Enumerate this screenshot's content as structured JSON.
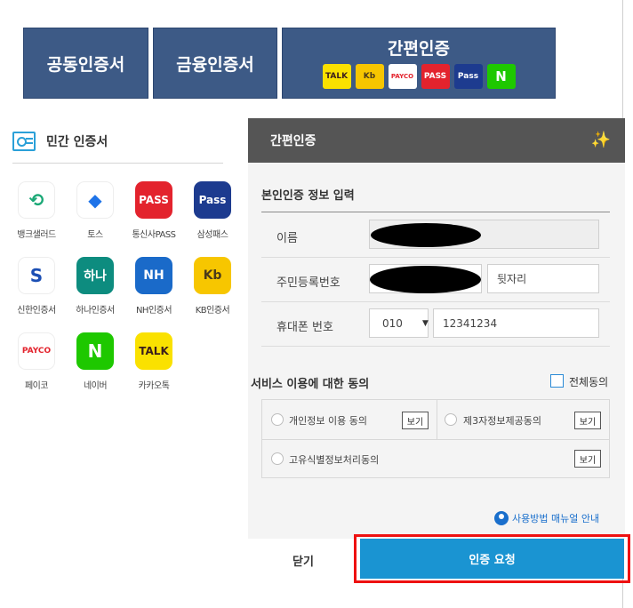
{
  "top_tabs": {
    "cert": "공동인증서",
    "financial": "금융인증서",
    "simple": "간편인증",
    "mini_icons": [
      "TALK",
      "Kb",
      "PAYCO",
      "PASS",
      "Pass",
      "N"
    ]
  },
  "private_certs": {
    "title": "민간 인증서",
    "apps": [
      {
        "name": "뱅크샐러드",
        "glyph": "⟲",
        "bg": "#ffffff",
        "fg": "#1aa876"
      },
      {
        "name": "토스",
        "glyph": "◆",
        "bg": "#ffffff",
        "fg": "#1e73e8"
      },
      {
        "name": "통신사PASS",
        "glyph": "PASS",
        "bg": "#e3232d",
        "fg": "#ffffff"
      },
      {
        "name": "삼성패스",
        "glyph": "Pass",
        "bg": "#1d3b8f",
        "fg": "#ffffff"
      },
      {
        "name": "신한인증서",
        "glyph": "S",
        "bg": "#ffffff",
        "fg": "#1c4fb4"
      },
      {
        "name": "하나인증서",
        "glyph": "하나",
        "bg": "#0d8c7f",
        "fg": "#ffffff"
      },
      {
        "name": "NH인증서",
        "glyph": "NH",
        "bg": "#1a6ac9",
        "fg": "#ffffff"
      },
      {
        "name": "KB인증서",
        "glyph": "Kb",
        "bg": "#f7c600",
        "fg": "#4a3a1a"
      },
      {
        "name": "페이코",
        "glyph": "PAYCO",
        "bg": "#ffffff",
        "fg": "#e3232d"
      },
      {
        "name": "네이버",
        "glyph": "N",
        "bg": "#1ec800",
        "fg": "#ffffff"
      },
      {
        "name": "카카오톡",
        "glyph": "TALK",
        "bg": "#fae100",
        "fg": "#3a1d1d"
      }
    ]
  },
  "panel": {
    "title": "간편인증",
    "section_info": "본인인증 정보 입력",
    "name_label": "이름",
    "rrn_label": "주민등록번호",
    "rrn_back_placeholder": "뒷자리",
    "phone_label": "휴대폰 번호",
    "phone_prefix": "010",
    "phone_number": "12341234",
    "consent_title": "서비스 이용에 대한 동의",
    "consent_all": "전체동의",
    "consents": [
      "개인정보 이용 동의",
      "제3자정보제공동의",
      "고유식별정보처리동의"
    ],
    "view_label": "보기",
    "manual_link": "사용방법 매뉴얼 안내",
    "close_label": "닫기",
    "request_label": "인증 요청"
  },
  "colors": {
    "tab_bg": "#3d5a86",
    "panel_header": "#555555",
    "request_button": "#1a94d2",
    "highlight": "#ee1111"
  }
}
